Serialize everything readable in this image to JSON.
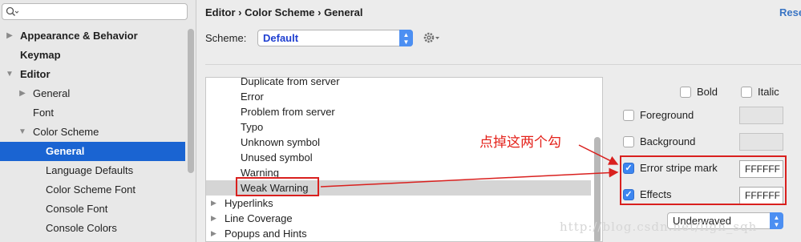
{
  "sidebar": {
    "search": {
      "value": "",
      "placeholder": ""
    },
    "items": [
      {
        "label": "Appearance & Behavior",
        "level": 0,
        "arrow": "▶",
        "bold": true,
        "selected": false
      },
      {
        "label": "Keymap",
        "level": 0,
        "arrow": "",
        "bold": true,
        "selected": false
      },
      {
        "label": "Editor",
        "level": 0,
        "arrow": "▼",
        "bold": true,
        "selected": false
      },
      {
        "label": "General",
        "level": 1,
        "arrow": "▶",
        "bold": false,
        "selected": false
      },
      {
        "label": "Font",
        "level": 1,
        "arrow": "",
        "bold": false,
        "selected": false
      },
      {
        "label": "Color Scheme",
        "level": 1,
        "arrow": "▼",
        "bold": false,
        "selected": false
      },
      {
        "label": "General",
        "level": 2,
        "arrow": "",
        "bold": false,
        "selected": true
      },
      {
        "label": "Language Defaults",
        "level": 2,
        "arrow": "",
        "bold": false,
        "selected": false
      },
      {
        "label": "Color Scheme Font",
        "level": 2,
        "arrow": "",
        "bold": false,
        "selected": false
      },
      {
        "label": "Console Font",
        "level": 2,
        "arrow": "",
        "bold": false,
        "selected": false
      },
      {
        "label": "Console Colors",
        "level": 2,
        "arrow": "",
        "bold": false,
        "selected": false
      }
    ]
  },
  "header": {
    "breadcrumb": "Editor › Color Scheme › General",
    "reset": "Rese"
  },
  "scheme": {
    "label": "Scheme:",
    "value": "Default"
  },
  "list": {
    "items": [
      {
        "label": "Duplicate from server",
        "tree": false,
        "selected": false
      },
      {
        "label": "Error",
        "tree": false,
        "selected": false
      },
      {
        "label": "Problem from server",
        "tree": false,
        "selected": false
      },
      {
        "label": "Typo",
        "tree": false,
        "selected": false
      },
      {
        "label": "Unknown symbol",
        "tree": false,
        "selected": false
      },
      {
        "label": "Unused symbol",
        "tree": false,
        "selected": false
      },
      {
        "label": "Warning",
        "tree": false,
        "selected": false
      },
      {
        "label": "Weak Warning",
        "tree": false,
        "selected": true
      },
      {
        "label": "Hyperlinks",
        "tree": true,
        "selected": false
      },
      {
        "label": "Line Coverage",
        "tree": true,
        "selected": false
      },
      {
        "label": "Popups and Hints",
        "tree": true,
        "selected": false
      }
    ]
  },
  "attributes": {
    "bold": {
      "label": "Bold",
      "checked": false
    },
    "italic": {
      "label": "Italic",
      "checked": false
    },
    "foreground": {
      "label": "Foreground",
      "checked": false,
      "color": ""
    },
    "background": {
      "label": "Background",
      "checked": false,
      "color": ""
    },
    "error_stripe": {
      "label": "Error stripe mark",
      "checked": true,
      "color": "FFFFFF"
    },
    "effects": {
      "label": "Effects",
      "checked": true,
      "color": "FFFFFF"
    },
    "effect_type": "Underwaved"
  },
  "annotation": {
    "note": "点掉这两个勾",
    "color": "#d9201e"
  },
  "watermark": "http://blog.csdn.net/ligh_sqh",
  "icons": {
    "search": "search-icon",
    "gear": "gear-icon",
    "dropdown": "chevron-updown-icon",
    "check": "✓"
  },
  "colors": {
    "selection": "#1a64d2",
    "accent": "#4c8ff2",
    "scheme_value": "#1f3fd1",
    "link": "#3a75c4"
  }
}
